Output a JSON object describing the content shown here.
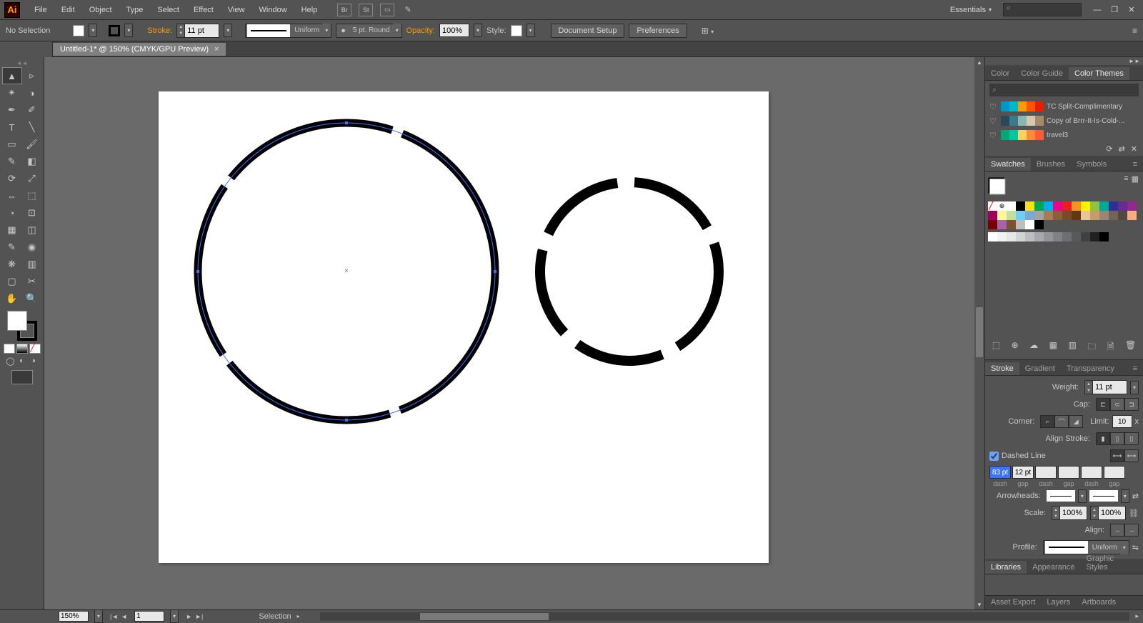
{
  "menubar": {
    "items": [
      "File",
      "Edit",
      "Object",
      "Type",
      "Select",
      "Effect",
      "View",
      "Window",
      "Help"
    ],
    "workspace": "Essentials"
  },
  "controlbar": {
    "selection": "No Selection",
    "stroke_label": "Stroke:",
    "stroke_weight": "11 pt",
    "profile": "Uniform",
    "brush": "5 pt. Round",
    "opacity_label": "Opacity:",
    "opacity": "100%",
    "style_label": "Style:",
    "doc_setup": "Document Setup",
    "prefs": "Preferences"
  },
  "doctab": {
    "title": "Untitled-1* @ 150% (CMYK/GPU Preview)"
  },
  "panels": {
    "color_tabs": [
      "Color",
      "Color Guide",
      "Color Themes"
    ],
    "swatch_tabs": [
      "Swatches",
      "Brushes",
      "Symbols"
    ],
    "stroke_tabs": [
      "Stroke",
      "Gradient",
      "Transparency"
    ],
    "lib_tabs": [
      "Libraries",
      "Appearance",
      "Graphic Styles"
    ],
    "footer_tabs": [
      "Asset Export",
      "Layers",
      "Artboards"
    ],
    "themes": [
      {
        "name": "TC Split-Complimentary",
        "colors": [
          "#0096c8",
          "#00b9c8",
          "#ff9a00",
          "#ff5500",
          "#e81e00"
        ]
      },
      {
        "name": "Copy of Brrr-It-Is-Cold-...",
        "colors": [
          "#2a4858",
          "#3a7a8a",
          "#8ab5b0",
          "#d8c8b0",
          "#a88a6a"
        ]
      },
      {
        "name": "travel3",
        "colors": [
          "#00a878",
          "#00c8a0",
          "#ffd060",
          "#ff8a3a",
          "#ff5a3a"
        ]
      }
    ],
    "swatches": [
      "#ffffff",
      "#000000",
      "#f7e214",
      "#00a651",
      "#00aeef",
      "#ec008c",
      "#ed1c24",
      "#f7941d",
      "#fff200",
      "#8dc63e",
      "#00a99d",
      "#2e3192",
      "#662d91",
      "#92278f",
      "#9e005d",
      "#fff799",
      "#c4df9b",
      "#6dcff6",
      "#7da7d9",
      "#a3a3a3",
      "#a67c52",
      "#8b5e3c",
      "#754c29",
      "#603913",
      "#e9c49a",
      "#c69c6d",
      "#998675",
      "#736357",
      "#534741",
      "#f9ad81",
      "#790000",
      "#a864a8",
      "#7a5230",
      "#bcbec0",
      "#ffffff",
      "#000000"
    ],
    "grays": [
      "#ffffff",
      "#f1f2f2",
      "#e6e7e8",
      "#d1d3d4",
      "#bcbec0",
      "#a7a9ac",
      "#939598",
      "#808285",
      "#6d6e71",
      "#58595b",
      "#414042",
      "#231f20",
      "#000000"
    ]
  },
  "stroke": {
    "weight_lbl": "Weight:",
    "weight": "11 pt",
    "cap_lbl": "Cap:",
    "corner_lbl": "Corner:",
    "limit_lbl": "Limit:",
    "limit": "10",
    "limit_x": "x",
    "align_lbl": "Align Stroke:",
    "dashed_lbl": "Dashed Line",
    "dash_vals": [
      "83 pt",
      "12 pt",
      "",
      "",
      "",
      ""
    ],
    "dash_lbls": [
      "dash",
      "gap",
      "dash",
      "gap",
      "dash",
      "gap"
    ],
    "arrows_lbl": "Arrowheads:",
    "scale_lbl": "Scale:",
    "scale1": "100%",
    "scale2": "100%",
    "alignarr_lbl": "Align:",
    "profile_lbl": "Profile:",
    "profile": "Uniform"
  },
  "status": {
    "zoom": "150%",
    "page": "1",
    "tool": "Selection"
  }
}
